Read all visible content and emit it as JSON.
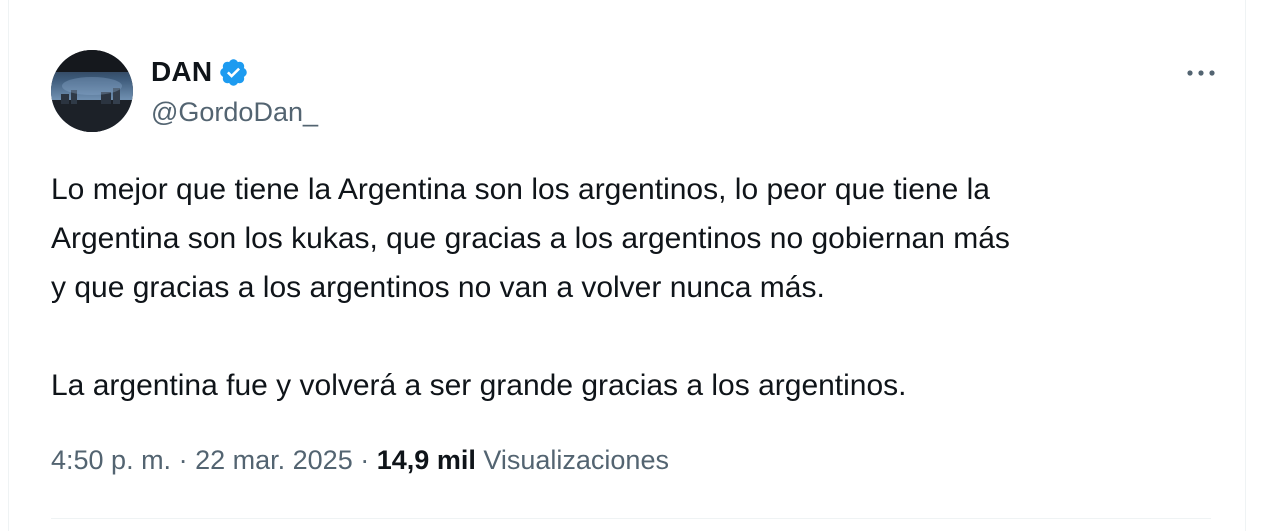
{
  "tweet": {
    "author": {
      "display_name": "DAN",
      "handle": "@GordoDan_",
      "verified_icon": "verified-badge-icon",
      "verified_color": "#1d9bf0"
    },
    "more_icon": "more-options-icon",
    "text_paragraph_1": "Lo mejor que tiene la Argentina son los argentinos, lo peor que tiene la\nArgentina son los kukas, que gracias a los argentinos no gobiernan más\ny que gracias a los argentinos no van a volver nunca más.",
    "text_paragraph_2": "La argentina fue y volverá a ser grande gracias a los argentinos.",
    "meta": {
      "time": "4:50 p. m.",
      "separator": "·",
      "date": "22 mar. 2025",
      "views_count": "14,9 mil",
      "views_label": "Visualizaciones"
    }
  }
}
